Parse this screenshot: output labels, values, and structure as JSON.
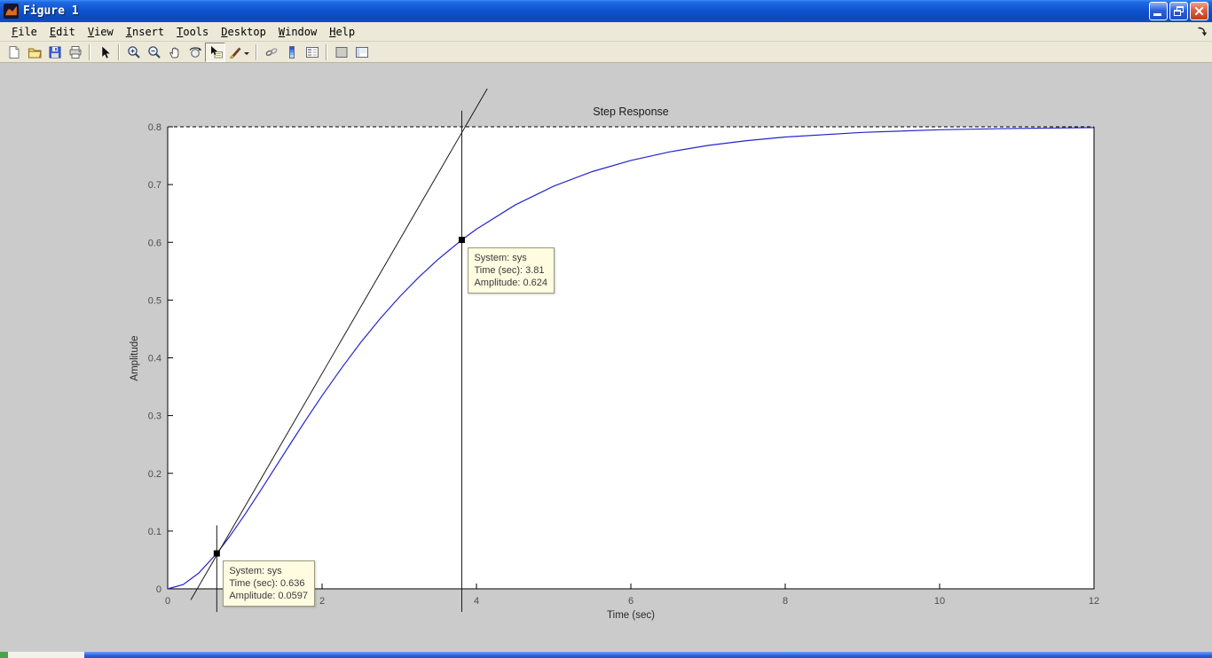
{
  "window": {
    "title": "Figure 1",
    "controls": [
      "minimize",
      "restore",
      "close"
    ]
  },
  "menu": {
    "items": [
      "File",
      "Edit",
      "View",
      "Insert",
      "Tools",
      "Desktop",
      "Window",
      "Help"
    ]
  },
  "toolbar": {
    "items": [
      {
        "name": "new-figure"
      },
      {
        "name": "open-file"
      },
      {
        "name": "save-figure"
      },
      {
        "name": "print-figure"
      },
      {
        "name": "edit-plot"
      },
      {
        "name": "zoom-in"
      },
      {
        "name": "zoom-out"
      },
      {
        "name": "pan"
      },
      {
        "name": "rotate-3d"
      },
      {
        "name": "data-cursor",
        "pressed": true
      },
      {
        "name": "brush"
      },
      {
        "name": "link-plot"
      },
      {
        "name": "insert-colorbar"
      },
      {
        "name": "insert-legend"
      },
      {
        "name": "hide-plot-tools"
      },
      {
        "name": "show-plot-tools"
      }
    ]
  },
  "chart_data": {
    "type": "line",
    "title": "Step Response",
    "xlabel": "Time (sec)",
    "ylabel": "Amplitude",
    "xlim": [
      0,
      12
    ],
    "ylim": [
      0,
      0.8
    ],
    "xticks": [
      0,
      2,
      4,
      6,
      8,
      10,
      12
    ],
    "yticks": [
      0,
      0.1,
      0.2,
      0.3,
      0.4,
      0.5,
      0.6,
      0.7,
      0.8
    ],
    "grid": false,
    "legend": null,
    "series": [
      {
        "name": "sys",
        "color": "#2424cc",
        "points": [
          [
            0,
            0
          ],
          [
            0.2,
            0.0074
          ],
          [
            0.4,
            0.0271
          ],
          [
            0.636,
            0.0613
          ],
          [
            0.8,
            0.0901
          ],
          [
            1,
            0.1286
          ],
          [
            1.2,
            0.1695
          ],
          [
            1.4,
            0.2114
          ],
          [
            1.6,
            0.2533
          ],
          [
            1.8,
            0.2945
          ],
          [
            2,
            0.3344
          ],
          [
            2.25,
            0.3819
          ],
          [
            2.5,
            0.4264
          ],
          [
            2.75,
            0.4675
          ],
          [
            3,
            0.5051
          ],
          [
            3.25,
            0.5393
          ],
          [
            3.5,
            0.5702
          ],
          [
            3.81,
            0.6042
          ],
          [
            4,
            0.6228
          ],
          [
            4.5,
            0.6646
          ],
          [
            5,
            0.6973
          ],
          [
            5.5,
            0.7225
          ],
          [
            6,
            0.7418
          ],
          [
            6.5,
            0.7565
          ],
          [
            7,
            0.7677
          ],
          [
            7.5,
            0.776
          ],
          [
            8,
            0.7823
          ],
          [
            9,
            0.7904
          ],
          [
            10,
            0.7949
          ],
          [
            11,
            0.7973
          ],
          [
            12,
            0.7986
          ]
        ]
      }
    ],
    "annotations": {
      "final_value_line": {
        "y": 0.8,
        "style": "dashed",
        "color": "#000000"
      },
      "tangent": {
        "from": [
          0.3,
          -0.019
        ],
        "to": [
          4.14,
          0.866
        ],
        "color": "#1a1a1a"
      },
      "vlines": [
        {
          "x": 0.636,
          "y1": -0.04,
          "y2": 0.11
        },
        {
          "x": 3.81,
          "y1": -0.04,
          "y2": 0.828
        }
      ],
      "markers": [
        [
          0.636,
          0.0613
        ],
        [
          3.81,
          0.6042
        ]
      ]
    },
    "datatips": [
      {
        "system": "System: sys",
        "time": "Time (sec): 0.636",
        "amplitude": "Amplitude: 0.0597"
      },
      {
        "system": "System: sys",
        "time": "Time (sec): 3.81",
        "amplitude": "Amplitude: 0.624"
      }
    ]
  }
}
